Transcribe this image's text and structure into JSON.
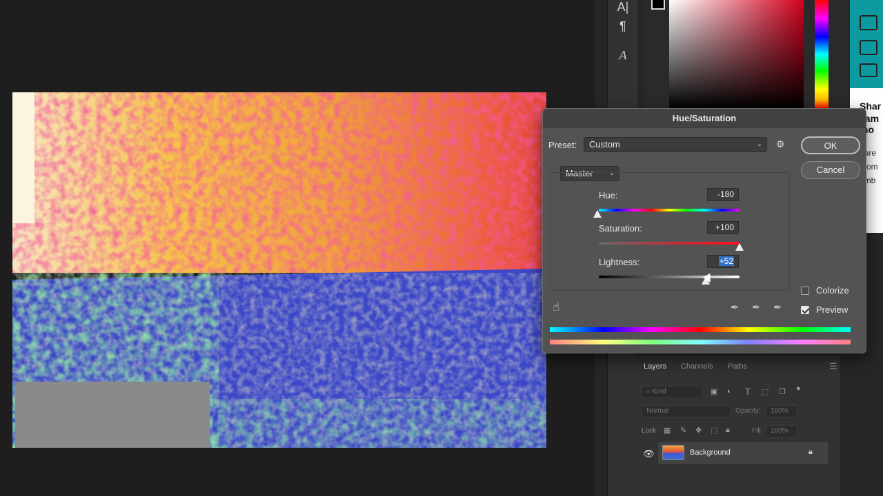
{
  "tools": [
    "A|",
    "¶",
    "A"
  ],
  "web": {
    "heading_lines": [
      "Shar",
      "eam",
      "mo"
    ],
    "body_lines": [
      "hare",
      "utom",
      "emb"
    ]
  },
  "dialog": {
    "title": "Hue/Saturation",
    "preset_label": "Preset:",
    "preset_value": "Custom",
    "channel_value": "Master",
    "ok_label": "OK",
    "cancel_label": "Cancel",
    "hue_label": "Hue:",
    "hue_value": "-180",
    "saturation_label": "Saturation:",
    "saturation_value": "+100",
    "lightness_label": "Lightness:",
    "lightness_value": "+52",
    "colorize_label": "Colorize",
    "colorize_checked": false,
    "preview_label": "Preview",
    "preview_checked": true
  },
  "layers": {
    "tabs": [
      "Layers",
      "Channels",
      "Paths"
    ],
    "kind_placeholder": "Kind",
    "blend_mode": "Normal",
    "opacity_label": "Opacity:",
    "opacity_value": "100%",
    "lock_label": "Lock:",
    "fill_label": "Fill:",
    "fill_value": "100%",
    "layer_name": "Background"
  }
}
